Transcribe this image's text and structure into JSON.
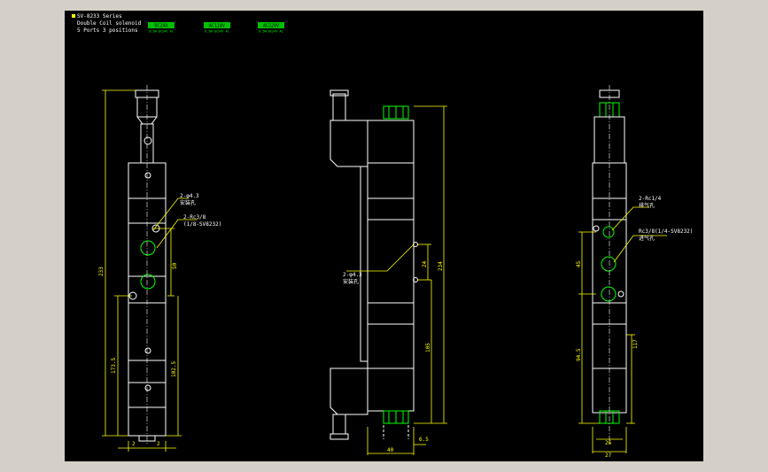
{
  "colors": {
    "background": "#000000",
    "frame": "#d4d0c8",
    "body": "#ffffff",
    "dimension": "#ffff00",
    "accent": "#00ff00"
  },
  "header": {
    "series": "SV-8233 Series",
    "line1": "Double Coil solenoid",
    "line2": "5 Ports 3 positions"
  },
  "badges": [
    {
      "label": "DC24V",
      "sub": "0.5W-DC24V AC"
    },
    {
      "label": "AC110V",
      "sub": "0.5W-DC24V AC"
    },
    {
      "label": "AC220V",
      "sub": "0.5W-DC24V AC"
    }
  ],
  "left_view": {
    "dim_total": "233",
    "dim_center": "50",
    "dim_lower": "173.5",
    "dim_mid_lower": "102.5",
    "dim_bottom_left": "2",
    "dim_bottom_right": "2",
    "callout_hole": "2-φ4.3",
    "callout_hole_note": "安装孔",
    "callout_port": "2-Rc3/8",
    "callout_port_note": "(1/8-SV8232)"
  },
  "middle_view": {
    "dim_height": "234",
    "dim_upper": "24",
    "dim_lower": "105",
    "dim_width": "40",
    "dim_offset": "6.5",
    "callout_hole": "2-φ4.3",
    "callout_hole_note": "安装孔"
  },
  "right_view": {
    "dim_upper": "45",
    "dim_lower": "94.5",
    "dim_height": "117",
    "dim_inner": "26",
    "dim_outer": "27",
    "callout_port": "2-Rc1/4",
    "callout_port_note": "排气孔",
    "callout_port2": "Rc3/8(1/4-SV8232)",
    "callout_port2_note": "进气孔"
  }
}
